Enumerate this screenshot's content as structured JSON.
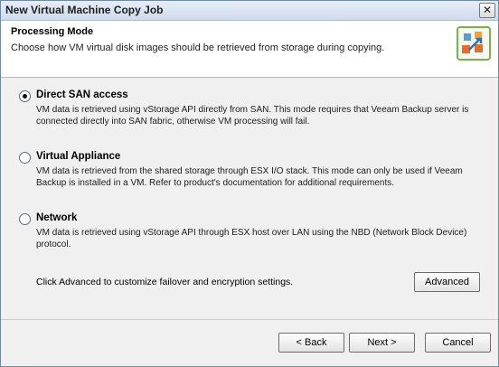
{
  "window": {
    "title": "New Virtual Machine Copy Job",
    "close_label": "✕"
  },
  "header": {
    "title": "Processing Mode",
    "subtitle": "Choose how VM virtual disk images should be retrieved from storage during copying.",
    "logo_icon": "veeam-arrows-icon"
  },
  "options": [
    {
      "label": "Direct SAN access",
      "checked": true,
      "description": "VM data is retrieved using vStorage API directly from SAN. This mode requires that Veeam Backup server is connected directly into SAN fabric, otherwise VM processing will fail."
    },
    {
      "label": "Virtual Appliance",
      "checked": false,
      "description": "VM data is retrieved from the shared storage through ESX I/O stack. This mode can only be used if Veeam Backup is installed in a VM. Refer to product's documentation for additional requirements."
    },
    {
      "label": "Network",
      "checked": false,
      "description": "VM data is retrieved using vStorage API through ESX host over LAN using the NBD (Network Block Device) protocol."
    }
  ],
  "advanced": {
    "text": "Click Advanced to customize failover and encryption settings.",
    "button_label": "Advanced"
  },
  "footer": {
    "back_label": "< Back",
    "next_label": "Next >",
    "cancel_label": "Cancel"
  }
}
